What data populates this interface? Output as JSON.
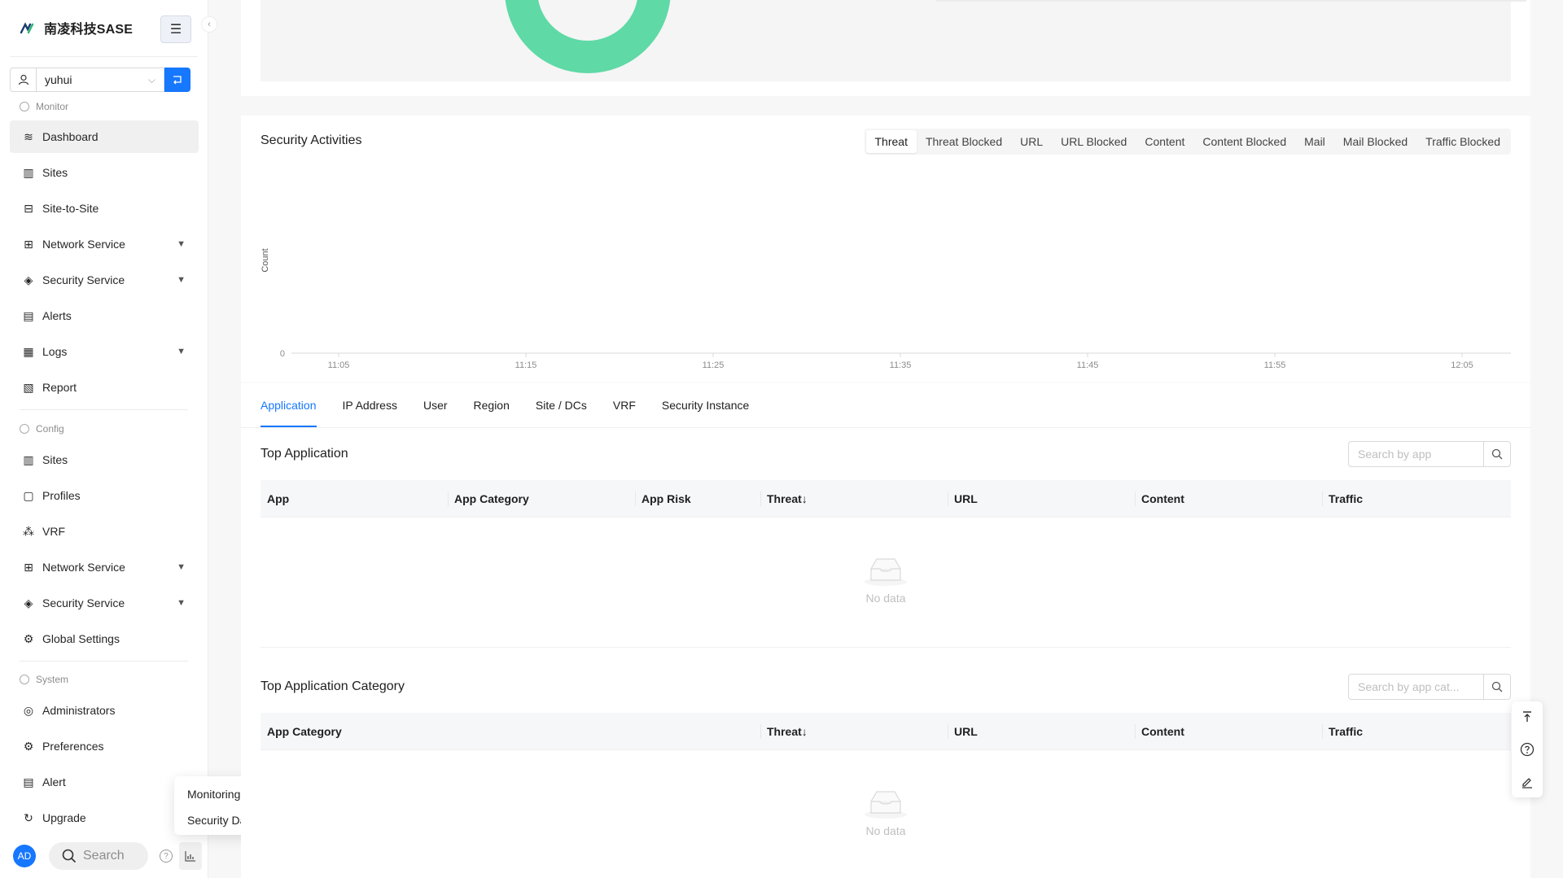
{
  "brand": {
    "name": "南凌科技SASE"
  },
  "tenant": {
    "value": "yuhui"
  },
  "sidebar": {
    "monitor_label": "Monitor",
    "monitor_items": [
      {
        "label": "Dashboard"
      },
      {
        "label": "Sites"
      },
      {
        "label": "Site-to-Site"
      },
      {
        "label": "Network Service"
      },
      {
        "label": "Security Service"
      },
      {
        "label": "Alerts"
      },
      {
        "label": "Logs"
      },
      {
        "label": "Report"
      }
    ],
    "config_label": "Config",
    "config_items": [
      {
        "label": "Sites"
      },
      {
        "label": "Profiles"
      },
      {
        "label": "VRF"
      },
      {
        "label": "Network Service"
      },
      {
        "label": "Security Service"
      },
      {
        "label": "Global Settings"
      }
    ],
    "system_label": "System",
    "system_items": [
      {
        "label": "Administrators"
      },
      {
        "label": "Preferences"
      },
      {
        "label": "Alert"
      },
      {
        "label": "Upgrade"
      }
    ]
  },
  "footer": {
    "avatar": "AD",
    "search_label": "Search"
  },
  "popover": {
    "items": [
      "Monitoring Dashboard",
      "Security Dashboard"
    ]
  },
  "security": {
    "title": "Security Activities",
    "segments": [
      "Threat",
      "Threat Blocked",
      "URL",
      "URL Blocked",
      "Content",
      "Content Blocked",
      "Mail",
      "Mail Blocked",
      "Traffic Blocked"
    ],
    "selected": "Threat"
  },
  "chart_data": {
    "type": "line",
    "title": "",
    "ylabel": "Count",
    "xlabel": "",
    "x": [
      "11:05",
      "11:15",
      "11:25",
      "11:35",
      "11:45",
      "11:55",
      "12:05"
    ],
    "y_ticks": [
      "0"
    ],
    "series": []
  },
  "tabs": [
    "Application",
    "IP Address",
    "User",
    "Region",
    "Site / DCs",
    "VRF",
    "Security Instance"
  ],
  "top_app": {
    "title": "Top Application",
    "search_placeholder": "Search by app",
    "columns": [
      "App",
      "App Category",
      "App Risk",
      "Threat",
      "URL",
      "Content",
      "Traffic"
    ],
    "empty": "No data"
  },
  "top_cat": {
    "title": "Top Application Category",
    "search_placeholder": "Search by app cat...",
    "columns": [
      "App Category",
      "Threat",
      "URL",
      "Content",
      "Traffic"
    ],
    "empty": "No data"
  },
  "colors": {
    "accent": "#1677ff",
    "donut": "#5fd9a6"
  }
}
